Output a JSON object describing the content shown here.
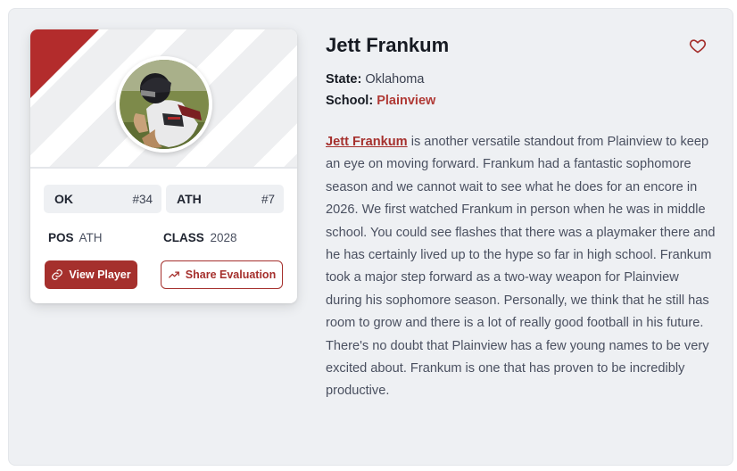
{
  "player": {
    "name": "Jett Frankum",
    "state_label": "State:",
    "state": "Oklahoma",
    "school_label": "School:",
    "school": "Plainview"
  },
  "card": {
    "state_abbr": "OK",
    "state_rank": "#34",
    "position_abbr": "ATH",
    "position_rank": "#7",
    "pos_label": "POS",
    "pos_value": "ATH",
    "class_label": "CLASS",
    "class_value": "2028",
    "view_button": "View Player",
    "share_button": "Share Evaluation"
  },
  "bio": {
    "link_name": "Jett Frankum",
    "text": " is another versatile standout from Plainview to keep an eye on moving forward. Frankum had a fantastic sophomore season and we cannot wait to see what he does for an encore in 2026. We first watched Frankum in person when he was in middle school. You could see flashes that there was a playmaker there and he has certainly lived up to the hype so far in high school. Frankum took a major step forward as a two-way weapon for Plainview during his sophomore season. Personally, we think that he still has room to grow and there is a lot of really good football in his future. There's no doubt that Plainview has a few young names to be very excited about. Frankum is one that has proven to be incredibly productive."
  },
  "icons": {
    "favorite": "heart-icon",
    "view": "link-icon",
    "share": "trending-up-icon"
  },
  "colors": {
    "accent": "#a5302d",
    "panel_bg": "#eef0f3"
  }
}
